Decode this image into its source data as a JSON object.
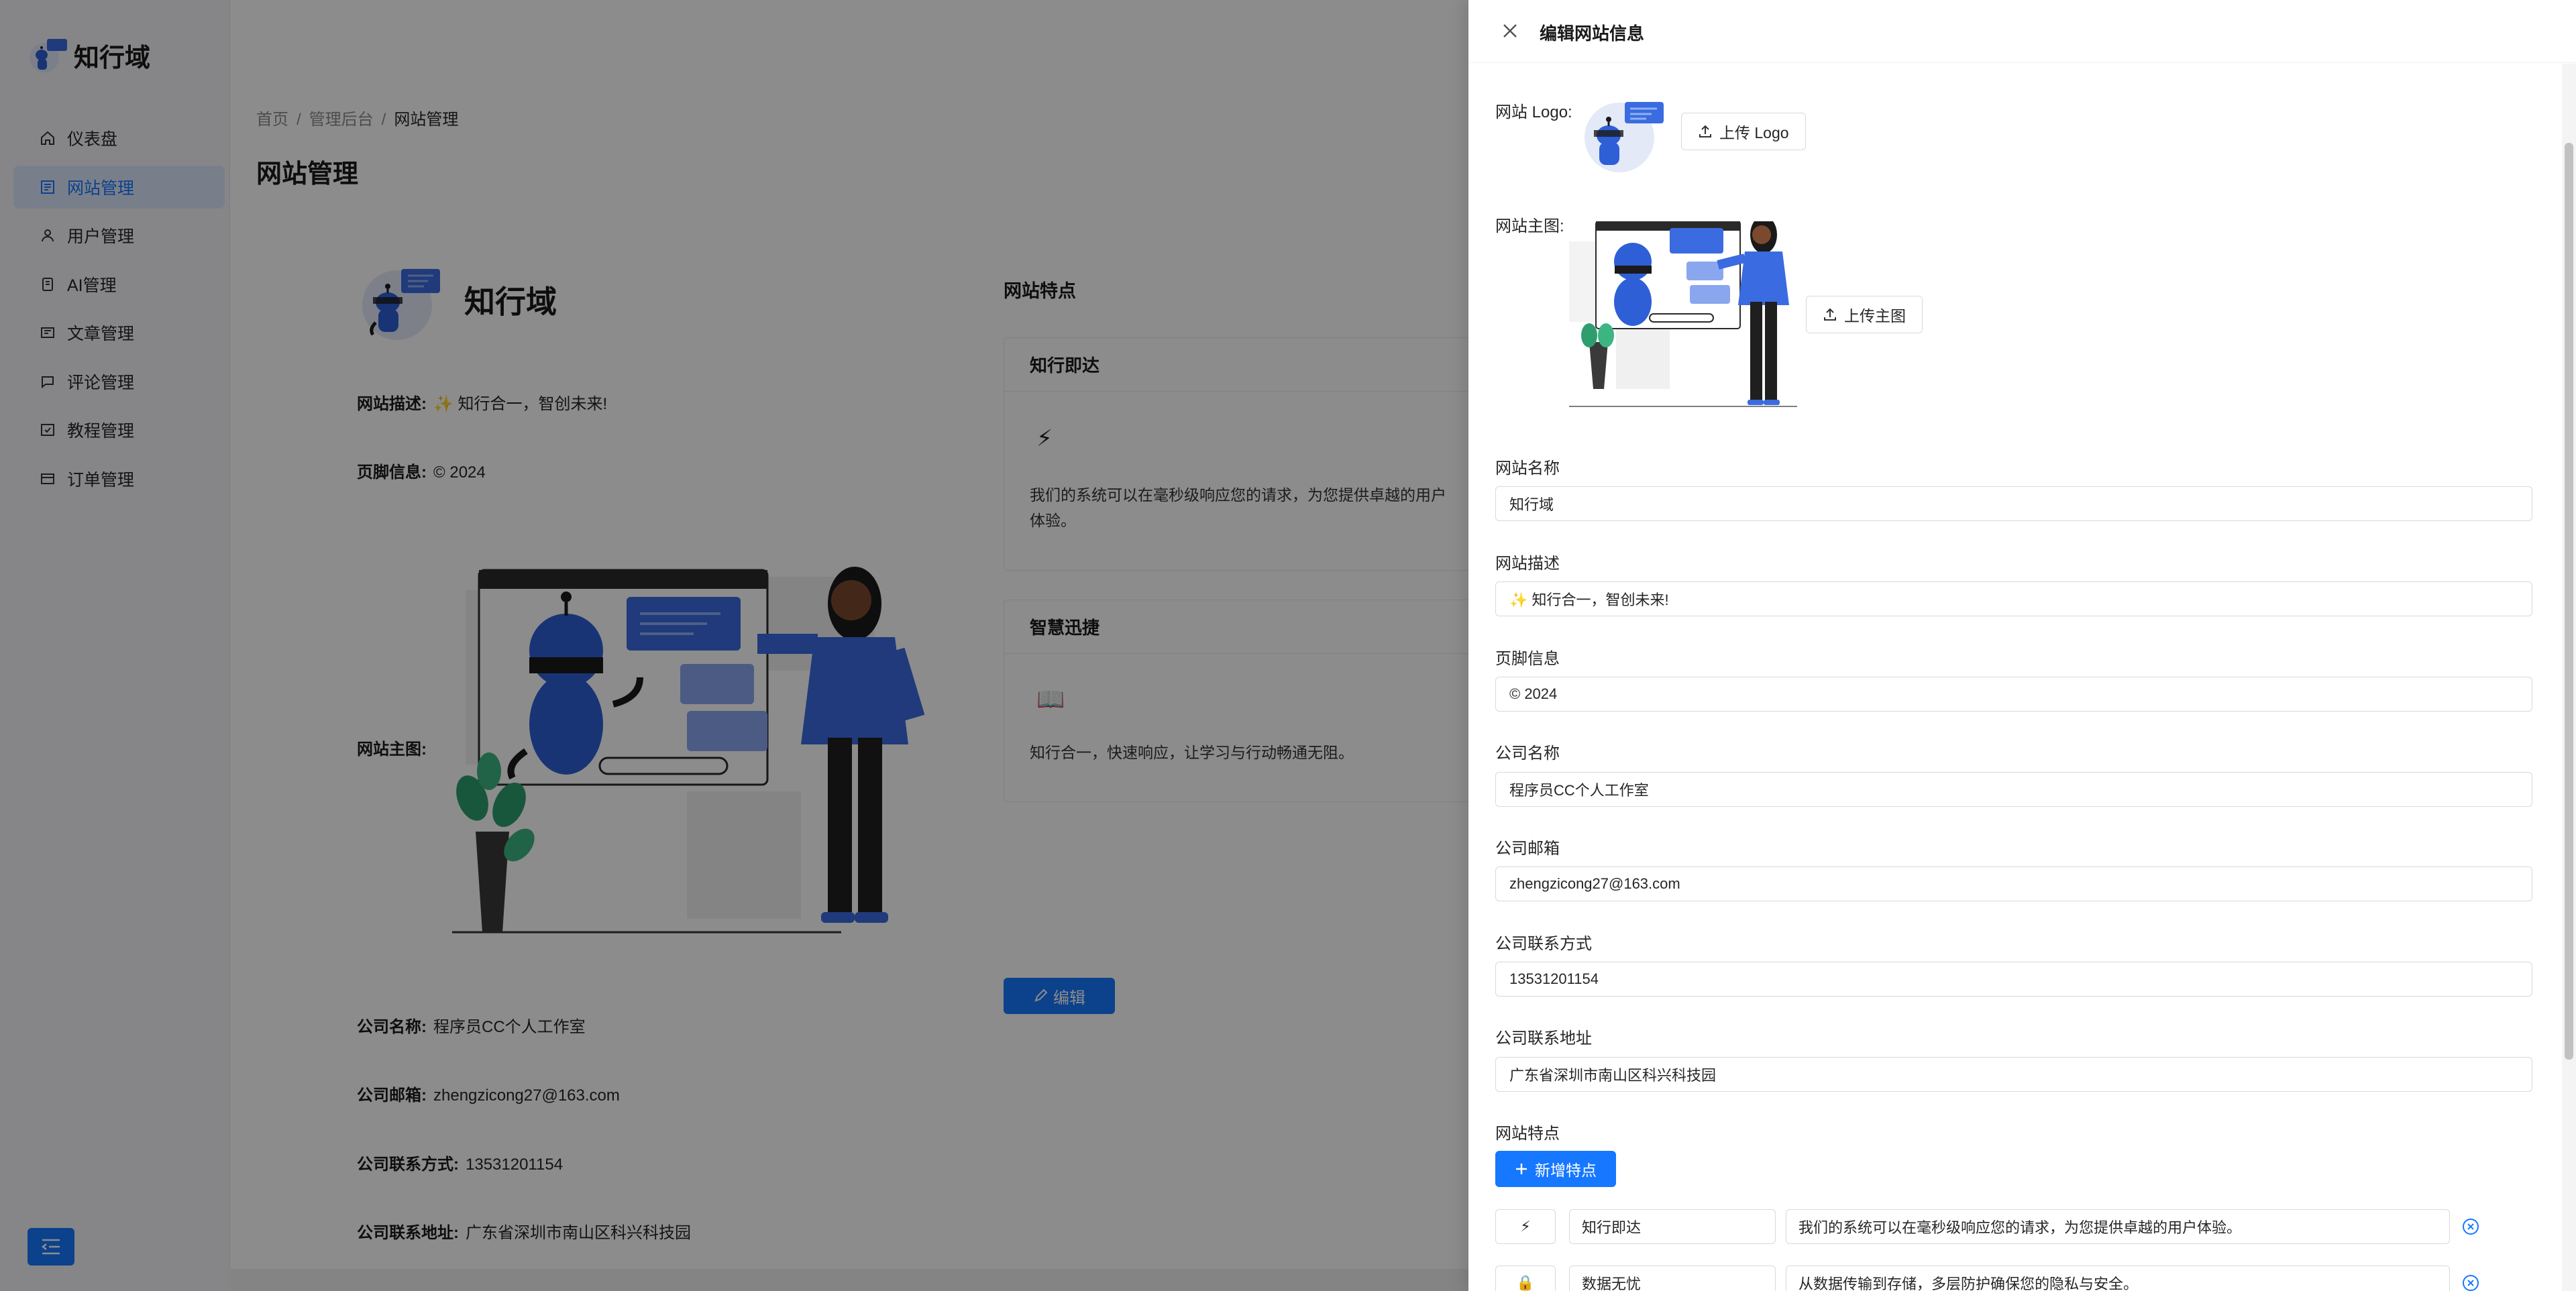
{
  "app": {
    "name": "知行域"
  },
  "sidebar": {
    "items": [
      {
        "label": "仪表盘",
        "icon": "home-icon"
      },
      {
        "label": "网站管理",
        "icon": "website-icon",
        "active": true
      },
      {
        "label": "用户管理",
        "icon": "user-icon"
      },
      {
        "label": "AI管理",
        "icon": "ai-icon"
      },
      {
        "label": "文章管理",
        "icon": "article-icon"
      },
      {
        "label": "评论管理",
        "icon": "comment-icon"
      },
      {
        "label": "教程管理",
        "icon": "tutorial-icon"
      },
      {
        "label": "订单管理",
        "icon": "order-icon"
      }
    ]
  },
  "breadcrumb": {
    "home": "首页",
    "admin": "管理后台",
    "current": "网站管理",
    "separator": "/"
  },
  "page": {
    "title": "网站管理"
  },
  "site_info": {
    "name": "知行域",
    "desc_label": "网站描述:",
    "desc_value": "✨ 知行合一，智创未来!",
    "footer_label": "页脚信息:",
    "footer_value": "© 2024",
    "hero_label": "网站主图:",
    "company_label": "公司名称:",
    "company_value": "程序员CC个人工作室",
    "email_label": "公司邮箱:",
    "email_value": "zhengzicong27@163.com",
    "phone_label": "公司联系方式:",
    "phone_value": "13531201154",
    "address_label": "公司联系地址:",
    "address_value": "广东省深圳市南山区科兴科技园"
  },
  "features_panel": {
    "title": "网站特点",
    "cards": [
      {
        "title": "知行即达",
        "icon": "⚡",
        "desc": "我们的系统可以在毫秒级响应您的请求，为您提供卓越的用户体验。"
      },
      {
        "title": "智慧迅捷",
        "icon": "📖",
        "desc": "知行合一，快速响应，让学习与行动畅通无阻。"
      }
    ],
    "edit_label": "编辑"
  },
  "drawer": {
    "title": "编辑网站信息",
    "logo_label": "网站 Logo:",
    "upload_logo": "上传 Logo",
    "hero_label": "网站主图:",
    "upload_hero": "上传主图",
    "fields": [
      {
        "label": "网站名称",
        "value": "知行域"
      },
      {
        "label": "网站描述",
        "value": "✨ 知行合一，智创未来!"
      },
      {
        "label": "页脚信息",
        "value": "© 2024"
      },
      {
        "label": "公司名称",
        "value": "程序员CC个人工作室"
      },
      {
        "label": "公司邮箱",
        "value": "zhengzicong27@163.com"
      },
      {
        "label": "公司联系方式",
        "value": "13531201154"
      },
      {
        "label": "公司联系地址",
        "value": "广东省深圳市南山区科兴科技园"
      }
    ],
    "features_label": "网站特点",
    "add_feature": "新增特点",
    "feature_rows": [
      {
        "icon": "⚡",
        "title": "知行即达",
        "desc": "我们的系统可以在毫秒级响应您的请求，为您提供卓越的用户体验。"
      },
      {
        "icon": "🔒",
        "title": "数据无忧",
        "desc": "从数据传输到存储，多层防护确保您的隐私与安全。"
      }
    ]
  },
  "colors": {
    "primary": "#1677ff",
    "active_bg": "#dce8fb",
    "robot_blue": "#2f5fd6"
  }
}
